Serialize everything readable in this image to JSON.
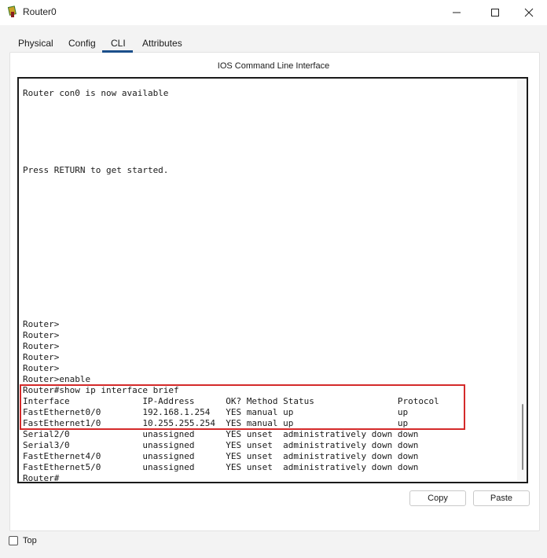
{
  "window": {
    "title": "Router0",
    "icon": "router-icon",
    "controls": [
      "minimize-icon",
      "maximize-icon",
      "close-icon"
    ]
  },
  "tabs": [
    {
      "label": "Physical"
    },
    {
      "label": "Config"
    },
    {
      "label": "CLI",
      "active": true
    },
    {
      "label": "Attributes"
    }
  ],
  "cli": {
    "header": "IOS Command Line Interface",
    "lines": [
      "Router con0 is now available",
      "Press RETURN to get started.",
      "Router>",
      "Router>",
      "Router>",
      "Router>",
      "Router>",
      "Router>enable",
      "Router#show ip interface brief",
      "Interface              IP-Address      OK? Method Status                Protocol",
      "FastEthernet0/0        192.168.1.254   YES manual up                    up",
      "FastEthernet1/0        10.255.255.254  YES manual up                    up",
      "Serial2/0              unassigned      YES unset  administratively down down",
      "Serial3/0              unassigned      YES unset  administratively down down",
      "FastEthernet4/0        unassigned      YES unset  administratively down down",
      "FastEthernet5/0        unassigned      YES unset  administratively down down",
      "Router#"
    ],
    "highlight_color": "#d42a2a"
  },
  "buttons": {
    "copy": "Copy",
    "paste": "Paste"
  },
  "footer": {
    "top_label": "Top",
    "top_checked": false
  },
  "colors": {
    "active_tab_underline": "#1b4f8a"
  }
}
